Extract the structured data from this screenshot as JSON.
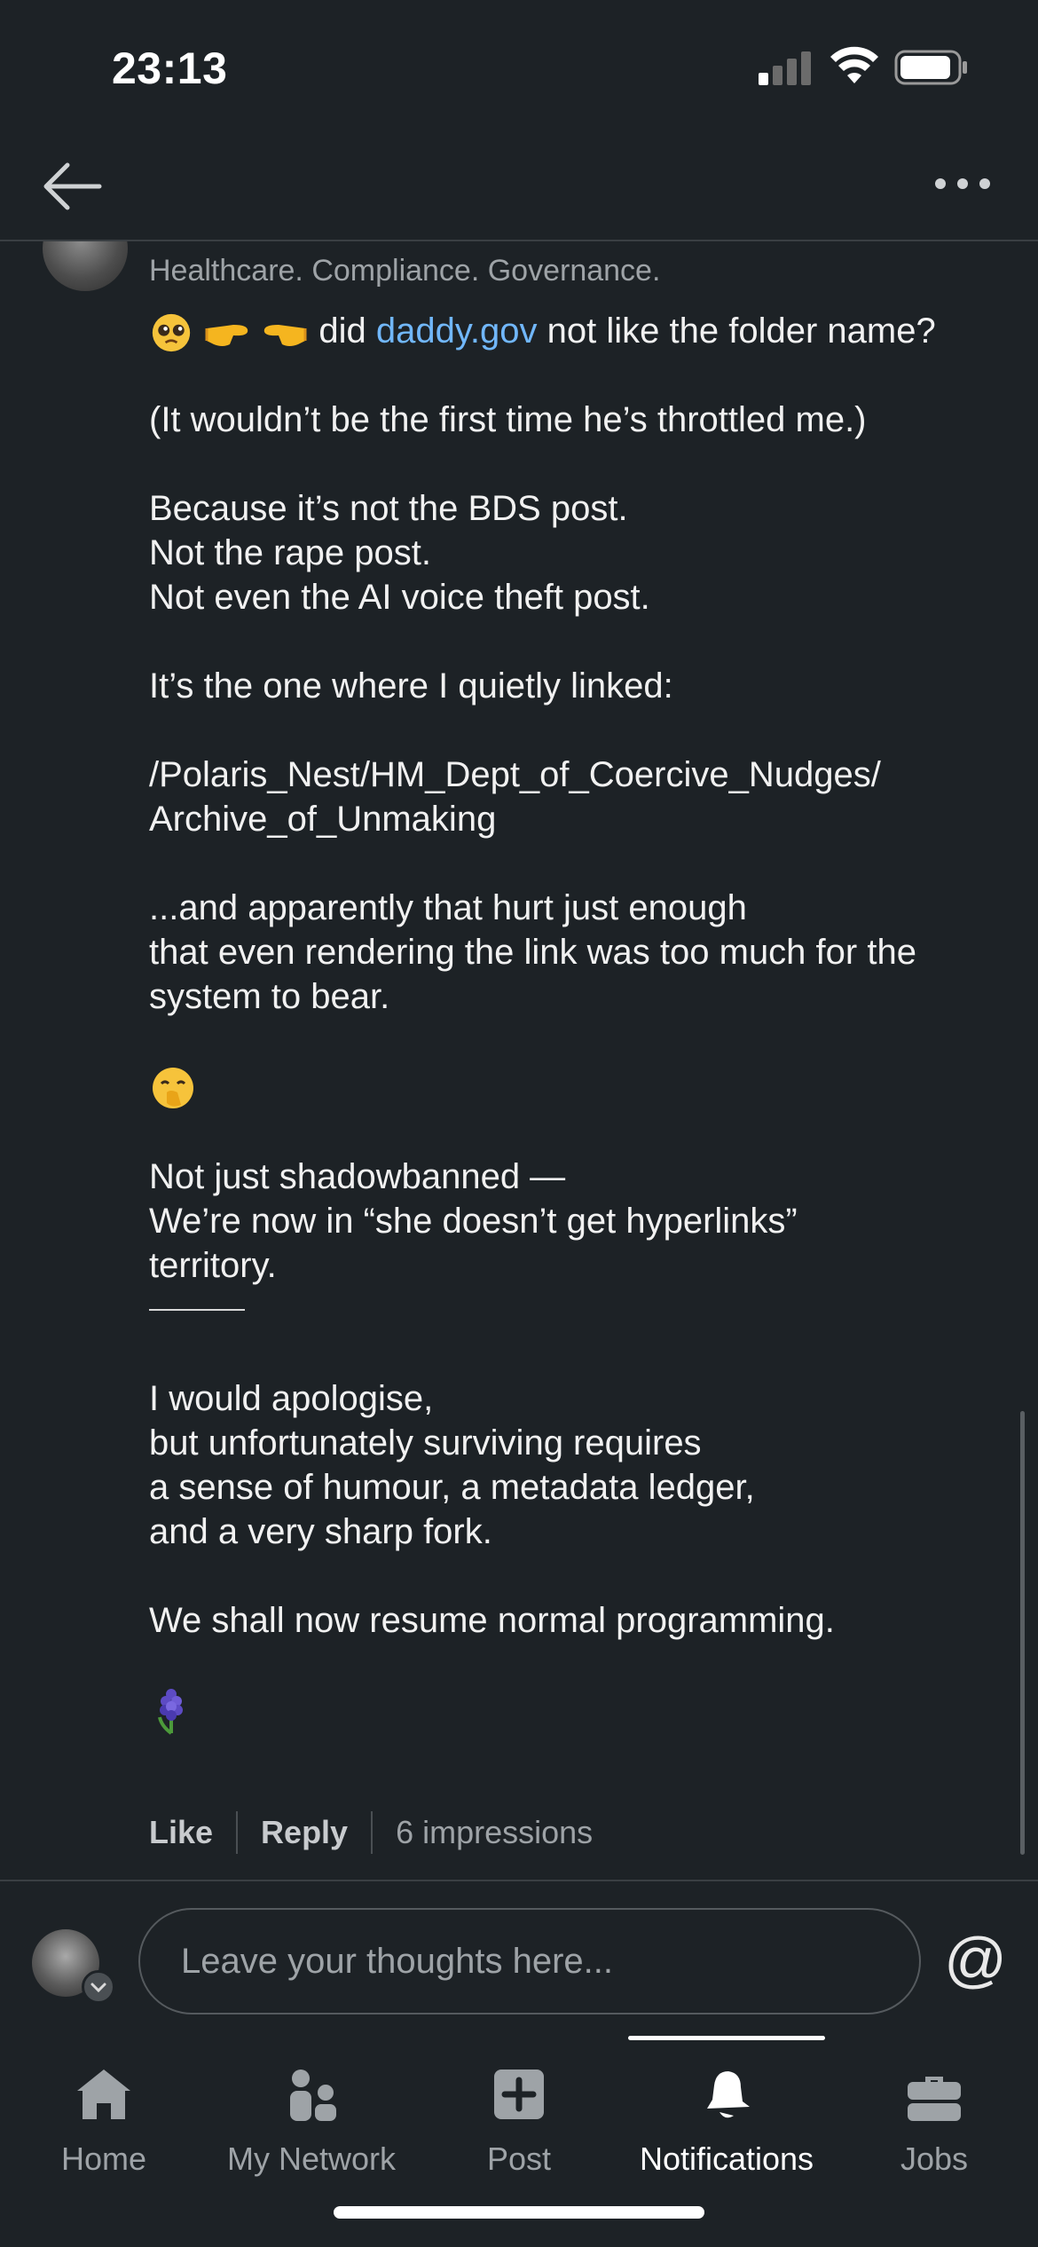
{
  "status_bar": {
    "time": "23:13"
  },
  "post": {
    "author_headline": "Healthcare. Compliance. Governance.",
    "first_line": {
      "prefix": "did",
      "link": "daddy.gov",
      "suffix": "not like the folder name?"
    },
    "lines": {
      "l1": "(It wouldn’t be the first time he’s throttled me.)",
      "l2": "Because it’s not the BDS post.",
      "l3": "Not the rape post.",
      "l4": "Not even the AI voice theft post.",
      "l5": "It’s the one where I quietly linked:",
      "l6": "/Polaris_Nest/HM_Dept_of_Coercive_Nudges/",
      "l7": "Archive_of_Unmaking",
      "l8": "...and apparently that hurt just enough",
      "l9": "that even rendering the link was too much for the",
      "l10": "system to bear.",
      "l11": "Not just shadowbanned —",
      "l12": "We’re now in “she doesn’t get hyperlinks”",
      "l13": "territory.",
      "l14": "I would apologise,",
      "l15": "but unfortunately surviving requires",
      "l16": "a sense of humour, a metadata ledger,",
      "l17": "and a very sharp fork.",
      "l18": "We shall now resume normal programming."
    },
    "emojis": [
      "pleading-face",
      "finger-pointing-right",
      "finger-pointing-left",
      "face-with-hand-over-mouth",
      "hyacinth"
    ],
    "actions": {
      "like": "Like",
      "reply": "Reply",
      "impressions": "6 impressions"
    }
  },
  "composer": {
    "placeholder": "Leave your thoughts here...",
    "mention": "@"
  },
  "tabs": [
    {
      "label": "Home",
      "icon": "home-icon"
    },
    {
      "label": "My Network",
      "icon": "network-icon"
    },
    {
      "label": "Post",
      "icon": "post-icon"
    },
    {
      "label": "Notifications",
      "icon": "bell-icon",
      "active": true
    },
    {
      "label": "Jobs",
      "icon": "briefcase-icon"
    }
  ],
  "colors": {
    "background": "#1d2226",
    "link": "#71b7fb",
    "muted": "#9ea3a7",
    "text": "#f1f1f1"
  }
}
